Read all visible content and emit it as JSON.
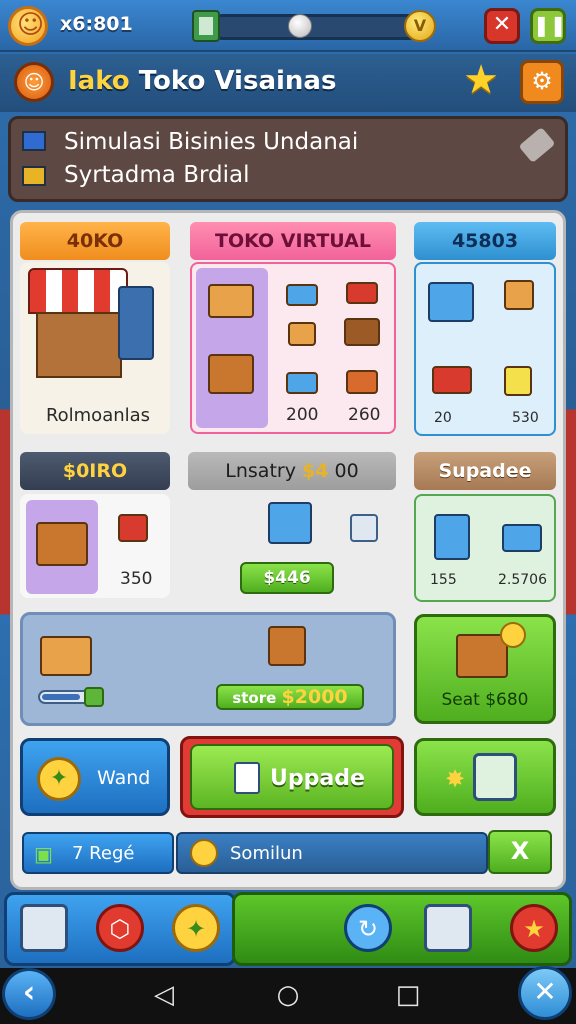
{
  "status_bar": {
    "coins": "x6:801"
  },
  "title": {
    "highlight": "Iako",
    "rest": " Toko Visainas"
  },
  "subtitle": {
    "line1": "Simulasi Bisinies Undanai",
    "line2": "Syrtadma Brdial"
  },
  "cards": {
    "retail": {
      "header": "40KO",
      "label": "Rolmoanlas"
    },
    "virtual": {
      "header": "TOKO VIRTUAL",
      "price1": "200",
      "price2": "260"
    },
    "bonus": {
      "header": "45803",
      "val1": "20",
      "val2": "530"
    },
    "money": {
      "header": "$0IRO",
      "price": "350"
    },
    "inventory": {
      "label": "Lnsatry",
      "amount": "$4",
      "suffix": "00",
      "button": "$446"
    },
    "upgrades": {
      "header": "Supadee",
      "val1": "155",
      "val2": "2.5706"
    }
  },
  "panels": {
    "store": {
      "label": "store",
      "amount": "$2000"
    },
    "sell": {
      "text": "Seat $680"
    }
  },
  "actions": {
    "wand": "Wand",
    "upgrade": "Uppade"
  },
  "info_bar": {
    "left": "7 Regé",
    "mid": "Somilun",
    "close": "X"
  },
  "colors": {
    "accent_gold": "#ffd23f",
    "green": "#4fae1f",
    "blue": "#1e6fc0",
    "red": "#e13b35"
  }
}
